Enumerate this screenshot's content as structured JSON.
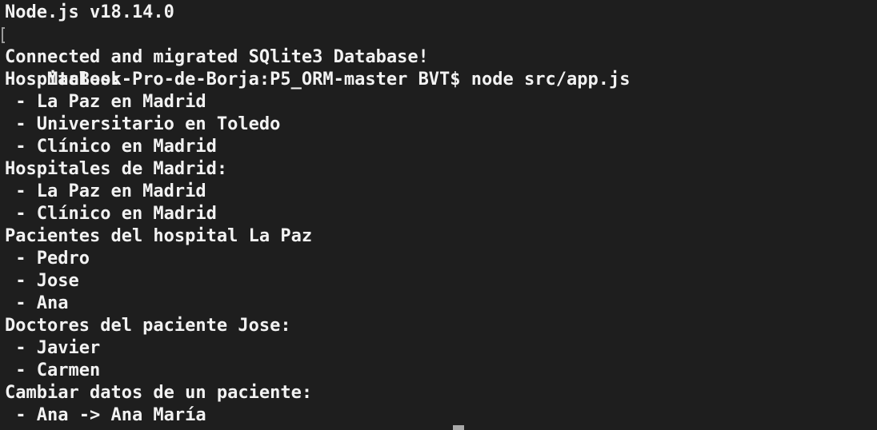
{
  "terminal": {
    "lines": [
      "Node.js v18.14.0",
      "MacBook-Pro-de-Borja:P5_ORM-master BVT$ node src/app.js",
      "Connected and migrated SQlite3 Database!",
      "Hospitales:",
      " - La Paz en Madrid",
      " - Universitario en Toledo",
      " - Clínico en Madrid",
      "Hospitales de Madrid:",
      " - La Paz en Madrid",
      " - Clínico en Madrid",
      "Pacientes del hospital La Paz",
      " - Pedro",
      " - Jose",
      " - Ana",
      "Doctores del paciente Jose:",
      " - Javier",
      " - Carmen",
      "Cambiar datos de un paciente:",
      " - Ana -> Ana María"
    ]
  },
  "colors": {
    "background": "#1e1e1e",
    "text": "#f2f2f2",
    "cursor": "#a9a9a9"
  }
}
